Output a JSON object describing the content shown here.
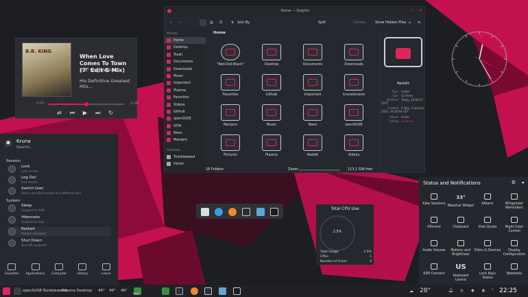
{
  "player": {
    "cover_text": "B.B. KING",
    "title": "When Love Comes To Town (7\" Edit & Mix)",
    "artist": "B.B. King With U2",
    "album": "His Definitive Greatest Hits...",
    "elapsed": "2:07",
    "remaining": "-2:06",
    "progress": 0.5
  },
  "launcher": {
    "user": "Kruna",
    "search_placeholder": "Search...",
    "session_label": "Session",
    "system_label": "System",
    "session_items": [
      {
        "label": "Lock",
        "sub": "Lock screen"
      },
      {
        "label": "Log Out",
        "sub": "End session"
      },
      {
        "label": "Switch User",
        "sub": "Start a parallel session as a different user"
      }
    ],
    "system_items": [
      {
        "label": "Sleep",
        "sub": "Suspend to RAM"
      },
      {
        "label": "Hibernate",
        "sub": "Suspend to disk"
      },
      {
        "label": "Restart",
        "sub": "Restart computer"
      },
      {
        "label": "Shut Down",
        "sub": "Turn off computer"
      }
    ],
    "footer": [
      "Favorites",
      "Applications",
      "Computer",
      "History",
      "Leave"
    ]
  },
  "dolphin": {
    "title": "Home — Dolphin",
    "sort": "Sort By",
    "split": "Split",
    "delete": "Delete",
    "hidden": "Show Hidden Files",
    "places_header": "Places",
    "devices_header": "Devices",
    "places": [
      "Home",
      "Desktop",
      "Trash",
      "Documents",
      "Downloads",
      "Music",
      "Important",
      "Plasma",
      "Favorites",
      "Videos",
      "Github",
      "openSUSE",
      "IOTA",
      "Neon",
      "Manjaro"
    ],
    "devices": [
      "Tumbleweed",
      "Home"
    ],
    "breadcrumb": "Home",
    "folders": [
      "\"Red-Dot-Black\"",
      "Desktop",
      "Documents",
      "Downloads",
      "Favorites",
      "Github",
      "Important",
      "kruna&ivana",
      "Manjaro",
      "Music",
      "Neon",
      "openSUSE",
      "Pictures",
      "Plasma",
      "Reddit",
      "Videos"
    ],
    "status_count": "16 Folders",
    "zoom_label": "Zoom:",
    "free": "113,1 GiB free",
    "info": {
      "name": "Reddit",
      "rows": [
        {
          "k": "Type:",
          "v": "Folder"
        },
        {
          "k": "Size:",
          "v": "12 items"
        },
        {
          "k": "Modified:",
          "v": "Today, 20:48:57 CEST"
        },
        {
          "k": "Created:",
          "v": "Friday, 1 January 2021, 19:16:04 CET"
        },
        {
          "k": "Owner:",
          "v": "kruna"
        },
        {
          "k": "Rating:",
          "v": "★★★★★"
        }
      ]
    }
  },
  "clock": {
    "hour": 12,
    "minute": 25
  },
  "cpu": {
    "title": "Total CPU Use",
    "percent": "2.5%",
    "rows": [
      {
        "k": "Total Usage",
        "v": "2.5%"
      },
      {
        "k": "CPUs",
        "v": "1"
      },
      {
        "k": "Number of Cores",
        "v": "4"
      }
    ]
  },
  "notifications": {
    "title": "Status and Notifications",
    "items": [
      "Kate Sessions",
      "Weather Widget",
      "KAlarm",
      "KOrganizer Reminders",
      "KTorrent",
      "Clipboard",
      "Disk Quota",
      "Night Color Control",
      "Audio Volume",
      "Battery and Brightness",
      "Disks & Devices",
      "Display Configuration",
      "KDE Connect",
      "Keyboard Layout",
      "Lock Keys Status",
      "Networks"
    ],
    "weather_temp": "33°",
    "keyboard_text": "US"
  },
  "taskbar": {
    "os": "openSUSE-Tumbleweed",
    "desktop": "Plasma Desktop",
    "temps": [
      "46°",
      "46°",
      "46°"
    ],
    "yast": "YAST",
    "weather": "28°",
    "time": "22:25"
  },
  "colors": {
    "accent": "#e0245e",
    "bg": "#1b1d22",
    "panel": "#24272d"
  }
}
